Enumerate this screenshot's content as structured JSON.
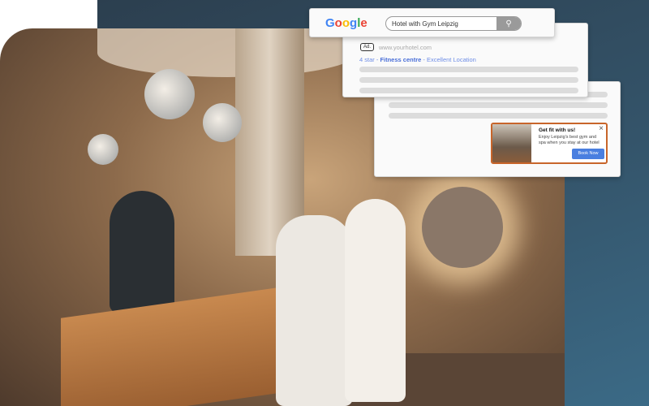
{
  "search_card": {
    "logo": "Google",
    "query": "Hotel with Gym Leipzig",
    "search_icon": "magnifier-icon"
  },
  "ad_card": {
    "badge": "Ad.",
    "url": "www.yourhotel.com",
    "tagline": [
      {
        "text": "4 star - ",
        "bold": false
      },
      {
        "text": "Fitness centre",
        "bold": true
      },
      {
        "text": " - Excellent Location",
        "bold": false
      }
    ]
  },
  "popup": {
    "title": "Get fit with us!",
    "body": "Enjoy Leipzig's best gym and spa when you stay at our hotel",
    "button": "Book Now",
    "close": "×"
  },
  "colors": {
    "accent": "#4a7fe0",
    "popup_border": "#c8652a",
    "background": "#2f4a5c"
  }
}
